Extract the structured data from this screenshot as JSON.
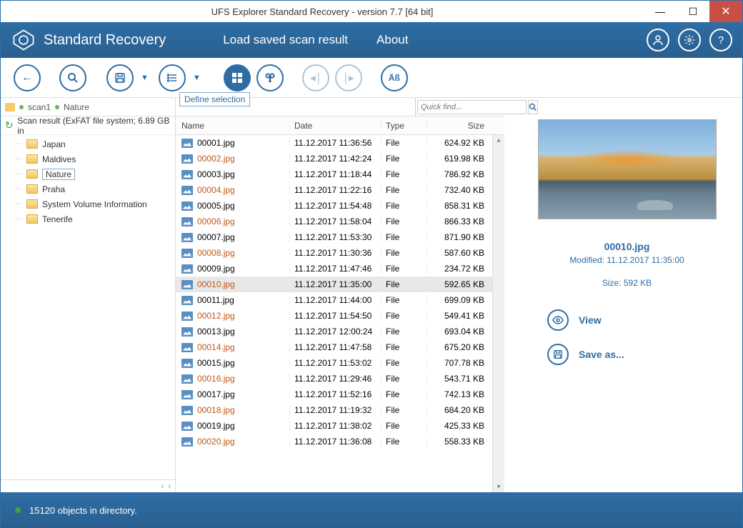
{
  "window": {
    "title": "UFS Explorer Standard Recovery - version 7.7 [64 bit]"
  },
  "app": {
    "name": "Standard Recovery"
  },
  "menu": {
    "load": "Load saved scan result",
    "about": "About"
  },
  "toolbar": {
    "tooltip": "Define selection"
  },
  "breadcrumb": {
    "p1": "scan1",
    "p2": "Nature"
  },
  "scan": {
    "header": "Scan result (ExFAT file system; 6.89 GB in"
  },
  "tree": {
    "items": [
      {
        "label": "Japan"
      },
      {
        "label": "Maldives"
      },
      {
        "label": "Nature",
        "selected": true
      },
      {
        "label": "Praha"
      },
      {
        "label": "System Volume Information"
      },
      {
        "label": "Tenerife"
      }
    ]
  },
  "search": {
    "placeholder": "Quick find..."
  },
  "columns": {
    "name": "Name",
    "date": "Date",
    "type": "Type",
    "size": "Size"
  },
  "files": [
    {
      "name": "00001.jpg",
      "date": "11.12.2017 11:36:56",
      "type": "File",
      "size": "624.92 KB"
    },
    {
      "name": "00002.jpg",
      "date": "11.12.2017 11:42:24",
      "type": "File",
      "size": "619.98 KB"
    },
    {
      "name": "00003.jpg",
      "date": "11.12.2017 11:18:44",
      "type": "File",
      "size": "786.92 KB"
    },
    {
      "name": "00004.jpg",
      "date": "11.12.2017 11:22:16",
      "type": "File",
      "size": "732.40 KB"
    },
    {
      "name": "00005.jpg",
      "date": "11.12.2017 11:54:48",
      "type": "File",
      "size": "858.31 KB"
    },
    {
      "name": "00006.jpg",
      "date": "11.12.2017 11:58:04",
      "type": "File",
      "size": "866.33 KB"
    },
    {
      "name": "00007.jpg",
      "date": "11.12.2017 11:53:30",
      "type": "File",
      "size": "871.90 KB"
    },
    {
      "name": "00008.jpg",
      "date": "11.12.2017 11:30:36",
      "type": "File",
      "size": "587.60 KB"
    },
    {
      "name": "00009.jpg",
      "date": "11.12.2017 11:47:46",
      "type": "File",
      "size": "234.72 KB"
    },
    {
      "name": "00010.jpg",
      "date": "11.12.2017 11:35:00",
      "type": "File",
      "size": "592.65 KB",
      "selected": true
    },
    {
      "name": "00011.jpg",
      "date": "11.12.2017 11:44:00",
      "type": "File",
      "size": "699.09 KB"
    },
    {
      "name": "00012.jpg",
      "date": "11.12.2017 11:54:50",
      "type": "File",
      "size": "549.41 KB"
    },
    {
      "name": "00013.jpg",
      "date": "11.12.2017 12:00:24",
      "type": "File",
      "size": "693.04 KB"
    },
    {
      "name": "00014.jpg",
      "date": "11.12.2017 11:47:58",
      "type": "File",
      "size": "675.20 KB"
    },
    {
      "name": "00015.jpg",
      "date": "11.12.2017 11:53:02",
      "type": "File",
      "size": "707.78 KB"
    },
    {
      "name": "00016.jpg",
      "date": "11.12.2017 11:29:46",
      "type": "File",
      "size": "543.71 KB"
    },
    {
      "name": "00017.jpg",
      "date": "11.12.2017 11:52:16",
      "type": "File",
      "size": "742.13 KB"
    },
    {
      "name": "00018.jpg",
      "date": "11.12.2017 11:19:32",
      "type": "File",
      "size": "684.20 KB"
    },
    {
      "name": "00019.jpg",
      "date": "11.12.2017 11:38:02",
      "type": "File",
      "size": "425.33 KB"
    },
    {
      "name": "00020.jpg",
      "date": "11.12.2017 11:36:08",
      "type": "File",
      "size": "558.33 KB"
    }
  ],
  "preview": {
    "name": "00010.jpg",
    "modified": "Modified: 11.12.2017 11:35:00",
    "size": "Size: 592 KB",
    "view": "View",
    "save": "Save as..."
  },
  "status": {
    "text": "15120 objects in directory."
  }
}
